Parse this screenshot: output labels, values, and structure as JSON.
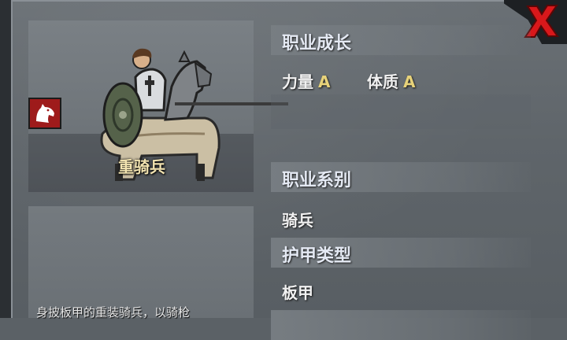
{
  "unit": {
    "name": "重骑兵",
    "class_icon": "horse-head-icon",
    "description": "身披板甲的重装骑兵，以骑枪"
  },
  "growth": {
    "title": "职业成长",
    "stats": [
      {
        "label": "力量",
        "grade": "A"
      },
      {
        "label": "体质",
        "grade": "A"
      }
    ]
  },
  "career_line": {
    "title": "职业系别",
    "value": "骑兵"
  },
  "armor_type": {
    "title": "护甲类型",
    "value": "板甲"
  },
  "close_button": {
    "icon": "close-x-icon",
    "color": "#d8181b"
  },
  "colors": {
    "grade": "#e7d27a",
    "unit_name": "#f2e3b0",
    "icon_bg": "#9e1b1b"
  }
}
